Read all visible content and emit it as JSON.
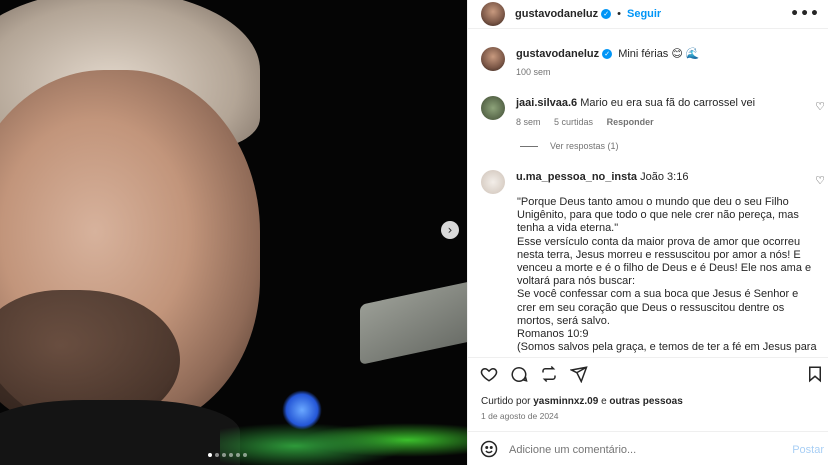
{
  "post": {
    "author": "gustavodaneluz",
    "follow_label": "Seguir",
    "more_label": "•••",
    "caption": "Mini férias 😊 🌊",
    "caption_time": "100 sem",
    "carousel_dots": 6
  },
  "comments": [
    {
      "user": "jaai.silvaa.6",
      "text": "Mario eu era sua fã do carrossel vei",
      "time": "8 sem",
      "likes": "5 curtidas",
      "reply_label": "Responder",
      "view_replies": "Ver respostas (1)"
    },
    {
      "user": "u.ma_pessoa_no_insta",
      "first_line": "João 3:16",
      "body": [
        "\"Porque Deus tanto amou o mundo que deu o seu Filho Unigênito, para que todo o que nele crer não pereça, mas tenha a vida eterna.\"",
        "Esse versículo conta da maior prova de amor que ocorreu nesta terra, Jesus morreu e ressuscitou por amor a nós! E venceu a morte e é o filho de Deus e é Deus! Ele nos ama e voltará para nós buscar:",
        "Se você confessar com a sua boca que Jesus é Senhor e crer em seu coração que Deus o ressuscitou dentre os mortos, será salvo.",
        "Romanos 10:9",
        "(Somos salvos pela graça, e temos de ter a fé em Jesus para"
      ]
    }
  ],
  "footer": {
    "liked_prefix": "Curtido por",
    "liked_user": "yasminnxz.09",
    "liked_and": "e",
    "liked_others": "outras pessoas",
    "date": "1 de agosto de 2024",
    "comment_placeholder": "Adicione um comentário...",
    "post_label": "Postar"
  },
  "colors": {
    "accent": "#0095f6",
    "muted": "#737373",
    "post_disabled": "#a9cff5"
  }
}
